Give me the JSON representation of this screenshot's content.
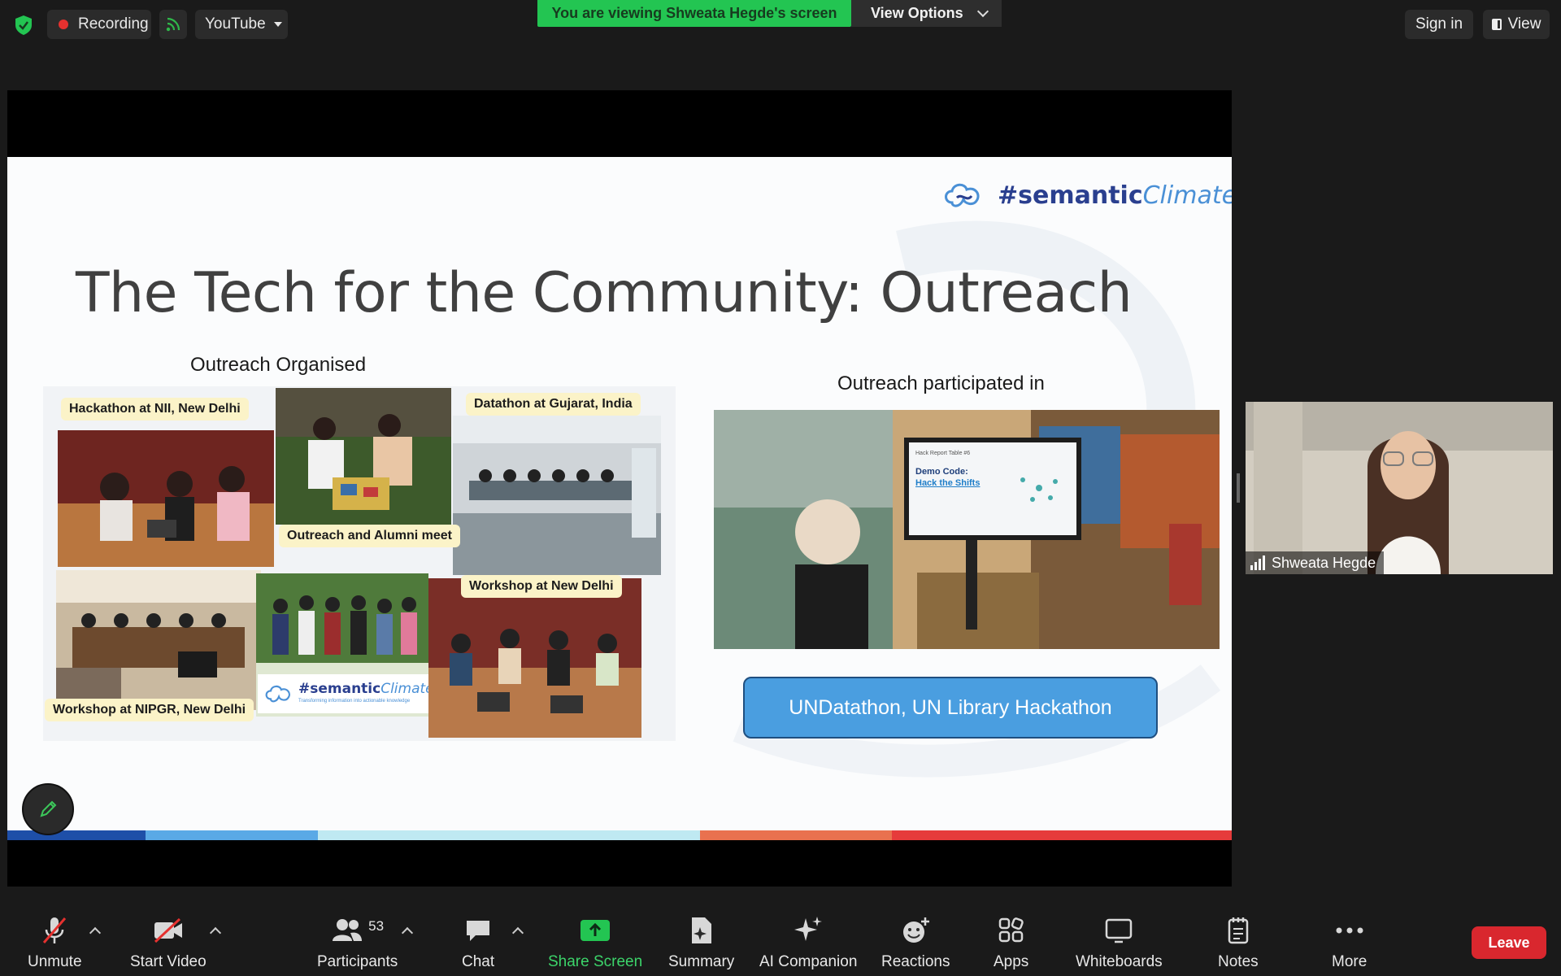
{
  "topbar": {
    "recording_label": "Recording",
    "stream_label": "YouTube",
    "viewing_banner": "You are viewing Shweata Hegde's screen",
    "view_options_label": "View Options",
    "sign_in_label": "Sign in",
    "view_label": "View"
  },
  "slide": {
    "title": "The Tech for the Community: Outreach",
    "logo_bold": "#semantic",
    "logo_italic": "Climate",
    "section_left": "Outreach Organised",
    "section_right": "Outreach participated in",
    "captions": {
      "hackathon": "Hackathon at NII, New Delhi",
      "datathon": "Datathon at Gujarat, India",
      "alumni": "Outreach and Alumni meet",
      "workshop_delhi": "Workshop at New Delhi",
      "workshop_nipgr": "Workshop at NIPGR, New Delhi"
    },
    "small_logo_bold": "#semantic",
    "small_logo_italic": "Climate",
    "small_logo_tagline": "Transforming information into actionable knowledge",
    "screen_heading": "Hack Report Table #6",
    "screen_demo_label": "Demo Code:",
    "screen_demo_link": "Hack the Shifts",
    "un_button": "UNDatathon, UN Library Hackathon"
  },
  "participant": {
    "name": "Shweata Hegde"
  },
  "toolbar": {
    "unmute": "Unmute",
    "start_video": "Start Video",
    "participants": "Participants",
    "participant_count": "53",
    "chat": "Chat",
    "share_screen": "Share Screen",
    "summary": "Summary",
    "ai_companion": "AI Companion",
    "reactions": "Reactions",
    "apps": "Apps",
    "whiteboards": "Whiteboards",
    "notes": "Notes",
    "more": "More",
    "leave": "Leave"
  },
  "colors": {
    "banner_green": "#23c552",
    "leave_red": "#d9272e",
    "share_green": "#23c552",
    "un_blue": "#4a9ee0"
  }
}
